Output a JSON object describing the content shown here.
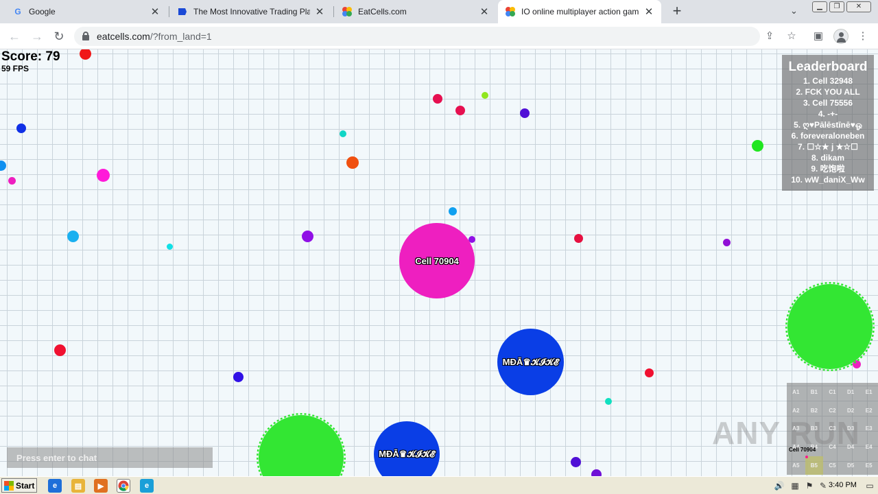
{
  "browser": {
    "tabs": [
      {
        "title": "Google",
        "favicon": "google-icon"
      },
      {
        "title": "The Most Innovative Trading Platform",
        "favicon": "trading-platform-icon"
      },
      {
        "title": "EatCells.com",
        "favicon": "eatcells-icon"
      },
      {
        "title": "IO online multiplayer action game. S",
        "favicon": "eatcells-icon",
        "active": true
      }
    ],
    "url_host": "eatcells.com",
    "url_path": "/?from_land=1"
  },
  "game": {
    "score_text": "Score: 79",
    "fps_text": "59 FPS",
    "leaderboard": {
      "title": "Leaderboard",
      "entries": [
        "1. Cell 32948",
        "2. FCK YOU ALL",
        "3. Cell 75556",
        "4. -+-",
        "5. ღ♥Pālēstīnē♥ஓ",
        "6. foreveraloneben",
        "7. ☐☆★ j ★☆☐",
        "8. dikam",
        "9. 吃饱啦",
        "10. wW_daniX_Ww"
      ]
    },
    "cells": [
      {
        "name": "Cell 70904",
        "color": "#ee1fc0"
      },
      {
        "name": "MĐĀ♛𝓚𝓘𝓚𝓔",
        "color": "#0a3ee6"
      },
      {
        "name": "MĐĀ♛𝓚𝓘𝓚𝓔",
        "color": "#0a3ee6"
      },
      {
        "name": "",
        "color": "#33e633"
      },
      {
        "name": "",
        "color": "#33e633"
      }
    ],
    "chat_placeholder": "Press enter to chat",
    "minimap": {
      "rows": [
        [
          "A1",
          "B1",
          "C1",
          "D1",
          "E1"
        ],
        [
          "A2",
          "B2",
          "C2",
          "D2",
          "E2"
        ],
        [
          "A3",
          "B3",
          "C3",
          "D3",
          "E3"
        ],
        [
          "A4",
          "B4",
          "C4",
          "D4",
          "E4"
        ],
        [
          "A5",
          "B5",
          "C5",
          "D5",
          "E5"
        ]
      ],
      "active_cell": "B5",
      "player_label": "Cell 70904"
    }
  },
  "watermark": "ANY RUN",
  "taskbar": {
    "start_label": "Start",
    "clock": "3:40 PM"
  }
}
